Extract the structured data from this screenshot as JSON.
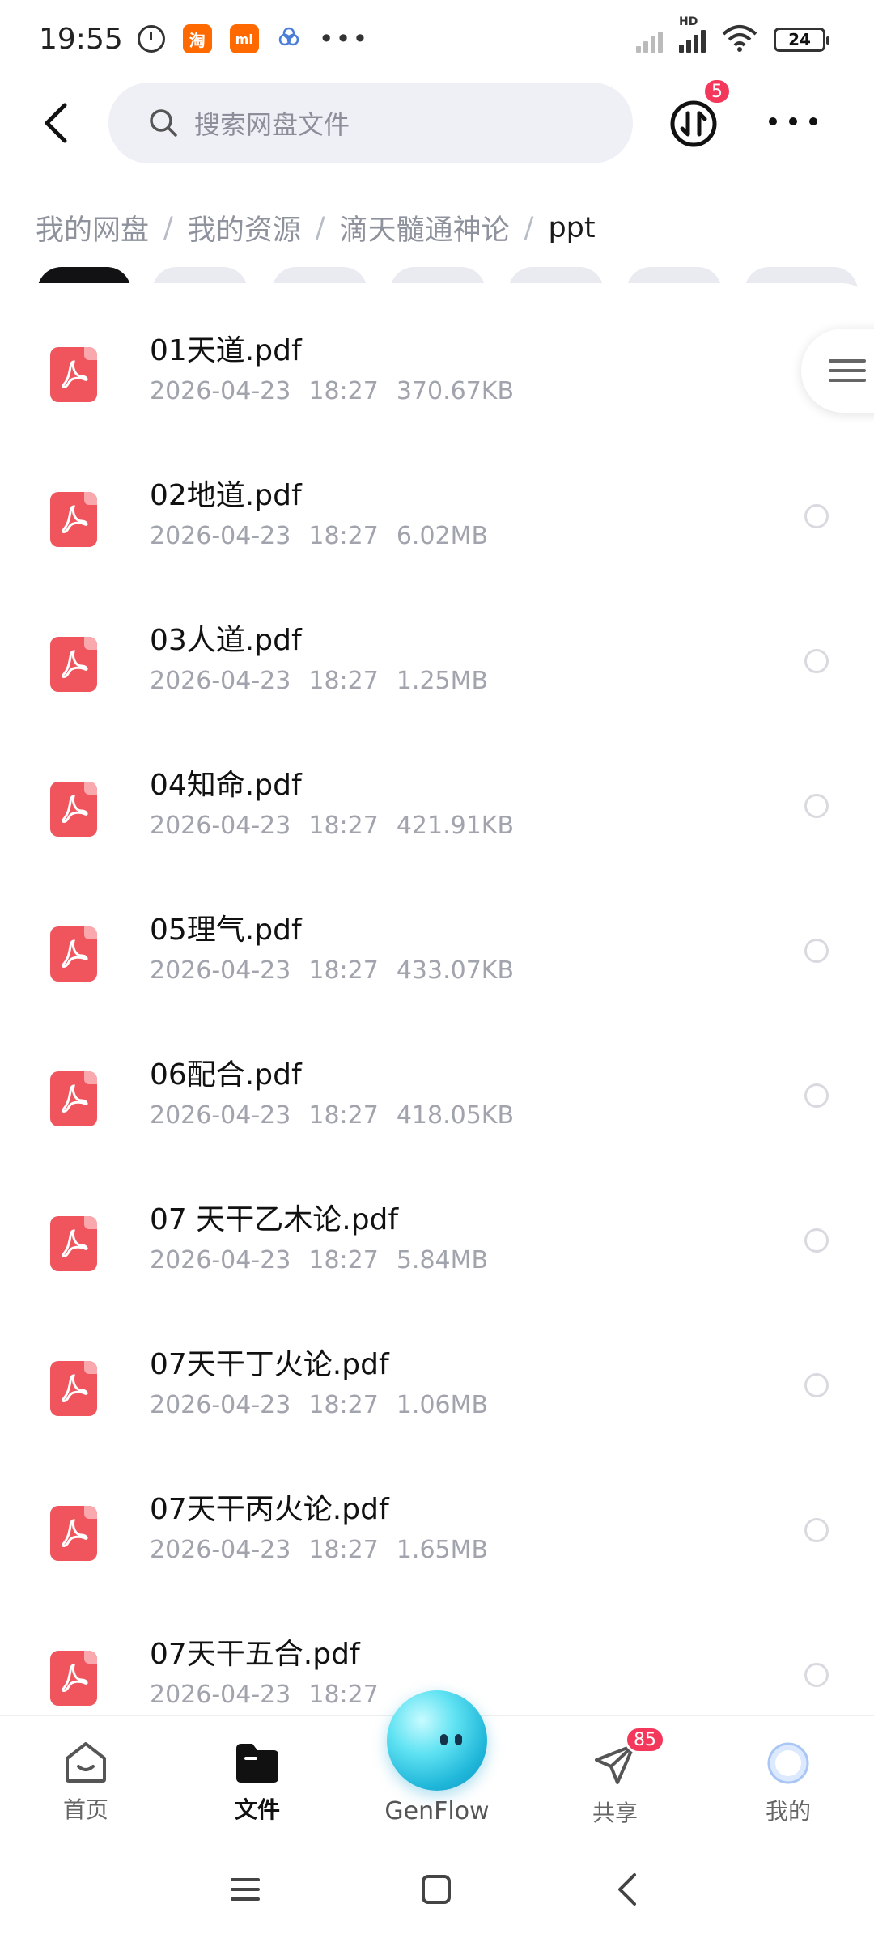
{
  "status_bar": {
    "time": "19:55",
    "app_icon_taobao": "淘",
    "app_icon_mi": "mi",
    "hd_label": "HD",
    "battery": "24"
  },
  "header": {
    "search_placeholder": "搜索网盘文件",
    "transfer_badge": "5"
  },
  "breadcrumb": {
    "items": [
      "我的网盘",
      "我的资源",
      "滴天髓通神论"
    ],
    "current": "ppt",
    "separator": "/"
  },
  "files": [
    {
      "name": "01天道.pdf",
      "date": "2026-04-23",
      "time": "18:27",
      "size": "370.67KB"
    },
    {
      "name": "02地道.pdf",
      "date": "2026-04-23",
      "time": "18:27",
      "size": "6.02MB"
    },
    {
      "name": "03人道.pdf",
      "date": "2026-04-23",
      "time": "18:27",
      "size": "1.25MB"
    },
    {
      "name": "04知命.pdf",
      "date": "2026-04-23",
      "time": "18:27",
      "size": "421.91KB"
    },
    {
      "name": "05理气.pdf",
      "date": "2026-04-23",
      "time": "18:27",
      "size": "433.07KB"
    },
    {
      "name": "06配合.pdf",
      "date": "2026-04-23",
      "time": "18:27",
      "size": "418.05KB"
    },
    {
      "name": "07 天干乙木论.pdf",
      "date": "2026-04-23",
      "time": "18:27",
      "size": "5.84MB"
    },
    {
      "name": "07天干丁火论.pdf",
      "date": "2026-04-23",
      "time": "18:27",
      "size": "1.06MB"
    },
    {
      "name": "07天干丙火论.pdf",
      "date": "2026-04-23",
      "time": "18:27",
      "size": "1.65MB"
    },
    {
      "name": "07天干五合.pdf",
      "date": "2026-04-23",
      "time": "18:27",
      "size": ""
    }
  ],
  "bottom_nav": {
    "home": "首页",
    "files": "文件",
    "genflow": "GenFlow",
    "share": "共享",
    "share_badge": "85",
    "mine": "我的"
  },
  "colors": {
    "pdf_icon": "#f0555e",
    "badge": "#f4385b",
    "search_bg": "#eef0f6"
  }
}
